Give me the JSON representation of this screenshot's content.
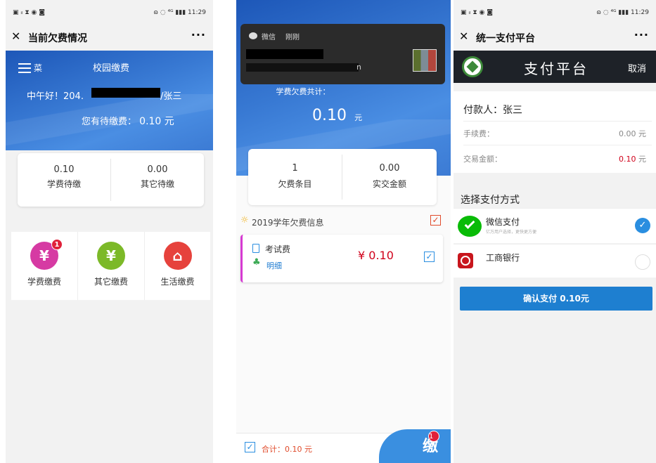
{
  "screen1": {
    "status": {
      "left": "▣ ᵢₗ ⧗ ◉ ◙",
      "right": "ɷ ◌ ⁴ᴳ ▮▮▮ 11:29"
    },
    "nav": {
      "close": "✕",
      "title": "当前欠费情况",
      "more": "···"
    },
    "header": {
      "menu_label": "菜",
      "title": "校园缴费"
    },
    "greeting_prefix": "中午好！204.",
    "greeting_suffix": "/张三",
    "pending_label": "您有待缴费：",
    "pending_value": "0.10 元",
    "summary": [
      {
        "value": "0.10",
        "label": "学费待缴"
      },
      {
        "value": "0.00",
        "label": "其它待缴"
      }
    ],
    "services": [
      {
        "icon": "¥",
        "label": "学费缴费",
        "badge": "1"
      },
      {
        "icon": "¥",
        "label": "其它缴费"
      },
      {
        "icon": "⌂",
        "label": "生活缴费"
      }
    ]
  },
  "screen2": {
    "notification": {
      "app": "微信",
      "time": "刚刚",
      "line2_tail": "n"
    },
    "total_label": "学费欠费共计：",
    "total_value": "0.10",
    "total_unit": "元",
    "summary": [
      {
        "value": "1",
        "label": "欠费条目"
      },
      {
        "value": "0.00",
        "label": "实交金额"
      }
    ],
    "section_title": "2019学年欠费信息",
    "item": {
      "name": "考试费",
      "detail": "明细",
      "amount": "¥ 0.10"
    },
    "footer": {
      "total": "合计：0.10 元",
      "fab_badge": "1",
      "fab_icon": "缴"
    }
  },
  "screen3": {
    "status": {
      "left": "▣ ᵢₗ ⧗ ◉ ◙",
      "right": "ɷ ◌ ⁴ᴳ ▮▮▮ 11:29"
    },
    "nav": {
      "close": "✕",
      "title": "统一支付平台",
      "more": "···"
    },
    "header": {
      "title": "支付平台",
      "cancel": "取消"
    },
    "payer_label": "付款人：张三",
    "fee_label": "手续费：",
    "fee_value": "0.00 元",
    "amount_label": "交易金额：",
    "amount_value": "0.10",
    "amount_unit": "元",
    "method_title": "选择支付方式",
    "methods": [
      {
        "name": "微信支付",
        "sub": "亿万用户选择，更快更方便"
      },
      {
        "name": "工商银行",
        "sub": ""
      }
    ],
    "confirm": "确认支付 0.10元"
  }
}
